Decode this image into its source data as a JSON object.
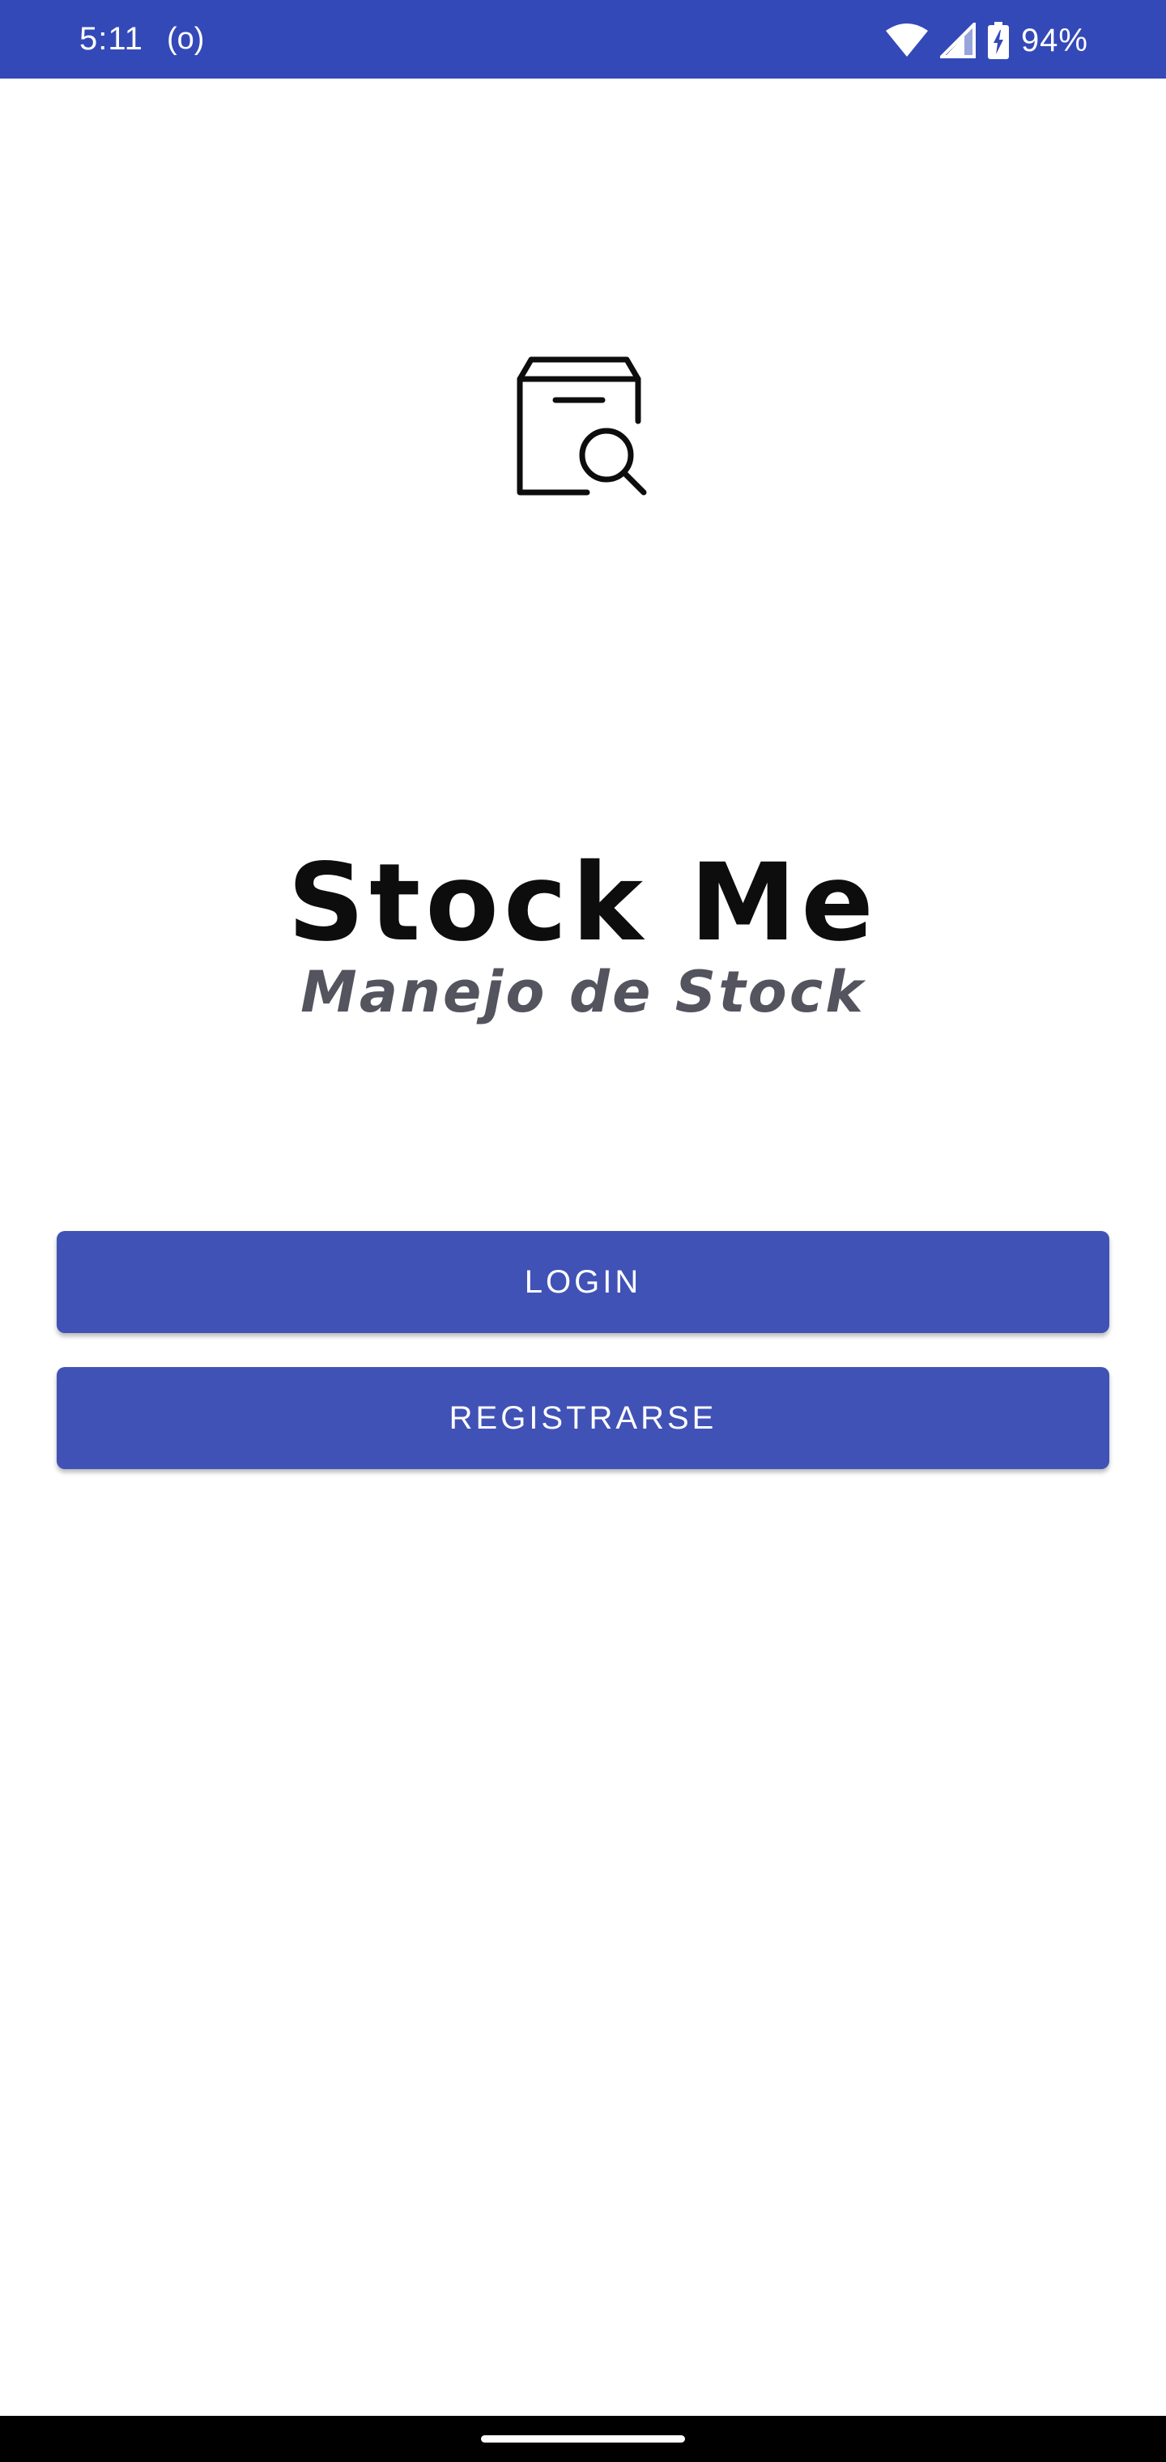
{
  "status_bar": {
    "time": "5:11",
    "radio_indicator": "(o)",
    "wifi_icon": "wifi-icon",
    "signal_icon": "signal-icon",
    "battery_icon": "battery-charging-icon",
    "battery_percent": "94%",
    "background_color": "#3449b8"
  },
  "logo": {
    "icon": "box-search-icon"
  },
  "branding": {
    "title": "Stock Me",
    "subtitle": "Manejo de Stock"
  },
  "actions": {
    "login_label": "LOGIN",
    "register_label": "REGISTRARSE",
    "button_color": "#4152b6"
  },
  "navigation_bar": {
    "handle": "home-gesture-handle"
  }
}
